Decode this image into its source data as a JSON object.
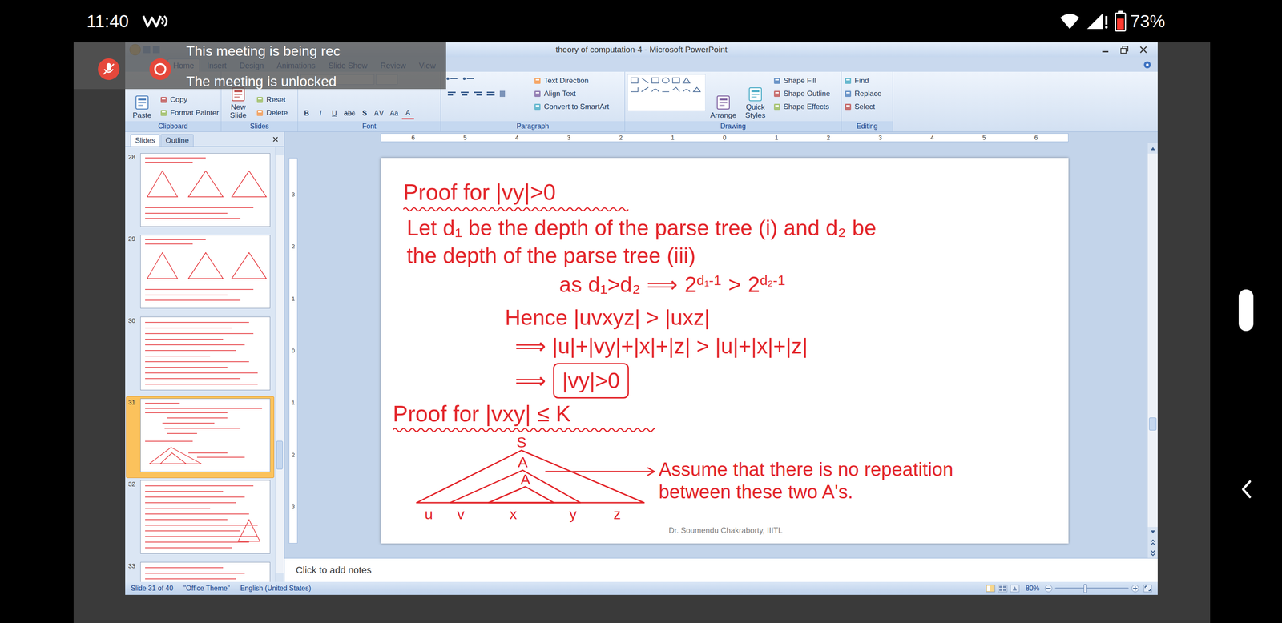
{
  "phone_status": {
    "time": "11:40",
    "battery": "73%",
    "battery_level": 0.73
  },
  "meeting_banner": {
    "lines": [
      "This meeting is being rec",
      "The meeting is unlocked"
    ]
  },
  "window": {
    "title": "theory of computation-4 - Microsoft PowerPoint"
  },
  "ribbon": {
    "tabs": [
      {
        "label": "Home",
        "selected": true
      },
      {
        "label": "Insert",
        "selected": false
      },
      {
        "label": "Design",
        "selected": false
      },
      {
        "label": "Animations",
        "selected": false
      },
      {
        "label": "Slide Show",
        "selected": false
      },
      {
        "label": "Review",
        "selected": false
      },
      {
        "label": "View",
        "selected": false
      }
    ],
    "groups": [
      {
        "label": "Clipboard",
        "items": [
          {
            "label": "Paste",
            "kind": "large"
          },
          {
            "label": "Copy",
            "kind": "small"
          },
          {
            "label": "Format Painter",
            "kind": "small"
          }
        ]
      },
      {
        "label": "Slides",
        "items": [
          {
            "label": "New Slide",
            "kind": "large"
          },
          {
            "label": "Reset",
            "kind": "small"
          },
          {
            "label": "Delete",
            "kind": "small"
          }
        ]
      },
      {
        "label": "Font",
        "items": [
          {
            "label": "B",
            "kind": "glyph"
          },
          {
            "label": "I",
            "kind": "glyph"
          },
          {
            "label": "U",
            "kind": "glyph"
          },
          {
            "label": "abc",
            "kind": "glyph"
          },
          {
            "label": "S",
            "kind": "glyph"
          },
          {
            "label": "AV",
            "kind": "glyph"
          },
          {
            "label": "Aa",
            "kind": "glyph"
          },
          {
            "label": "A",
            "kind": "glyph"
          }
        ]
      },
      {
        "label": "Paragraph",
        "items": [
          {
            "label": "Text Direction",
            "kind": "small"
          },
          {
            "label": "Align Text",
            "kind": "small"
          },
          {
            "label": "Convert to SmartArt",
            "kind": "small"
          }
        ]
      },
      {
        "label": "Drawing",
        "items": [
          {
            "label": "Arrange",
            "kind": "large"
          },
          {
            "label": "Quick Styles",
            "kind": "large"
          },
          {
            "label": "Shape Fill",
            "kind": "small"
          },
          {
            "label": "Shape Outline",
            "kind": "small"
          },
          {
            "label": "Shape Effects",
            "kind": "small"
          }
        ]
      },
      {
        "label": "Editing",
        "items": [
          {
            "label": "Find",
            "kind": "small"
          },
          {
            "label": "Replace",
            "kind": "small"
          },
          {
            "label": "Select",
            "kind": "small"
          }
        ]
      }
    ]
  },
  "slides_panel": {
    "tabs": [
      {
        "label": "Slides",
        "selected": true
      },
      {
        "label": "Outline",
        "selected": false
      }
    ],
    "thumbnails": [
      {
        "number": "28",
        "selected": false
      },
      {
        "number": "29",
        "selected": false
      },
      {
        "number": "30",
        "selected": false
      },
      {
        "number": "31",
        "selected": true
      },
      {
        "number": "32",
        "selected": false
      },
      {
        "number": "33",
        "selected": false
      }
    ]
  },
  "rulers": {
    "horizontal": [
      "6",
      "5",
      "4",
      "3",
      "2",
      "1",
      "0",
      "1",
      "2",
      "3",
      "4",
      "5",
      "6"
    ],
    "vertical": [
      "3",
      "2",
      "1",
      "0",
      "1",
      "2",
      "3"
    ]
  },
  "slide": {
    "heading_1": "Proof for |vy|>0",
    "definition_lines": [
      "Let d₁ be the depth of the parse tree (i) and d₂ be",
      "the depth of the parse tree (iii)"
    ],
    "comparison": {
      "prefix": "as d₁>d₂ ⟹",
      "left_base": "2",
      "left_exponent": "d₁-1",
      "relation": ">",
      "right_base": "2",
      "right_exponent": "d₂-1"
    },
    "hence": "Hence |uvxyz| > |uxz|",
    "expansion": "⟹ |u|+|vy|+|x|+|z| > |u|+|x|+|z|",
    "conclusion": {
      "arrow": "⟹",
      "boxed": "|vy|>0"
    },
    "heading_2": "Proof for |vxy| ≤ K",
    "tree": {
      "root": "S",
      "upper_node": "A",
      "lower_node": "A",
      "leaves": [
        "u",
        "v",
        "x",
        "y",
        "z"
      ]
    },
    "note_lines": [
      "Assume that there is no repeatition",
      "between these two A's."
    ],
    "footer": "Dr. Soumendu Chakraborty, IIITL"
  },
  "notes": {
    "placeholder": "Click to add notes"
  },
  "status_bar": {
    "slide": "Slide 31 of 40",
    "theme": "\"Office Theme\"",
    "language": "English (United States)",
    "zoom": "80%",
    "zoom_level": 0.41
  }
}
